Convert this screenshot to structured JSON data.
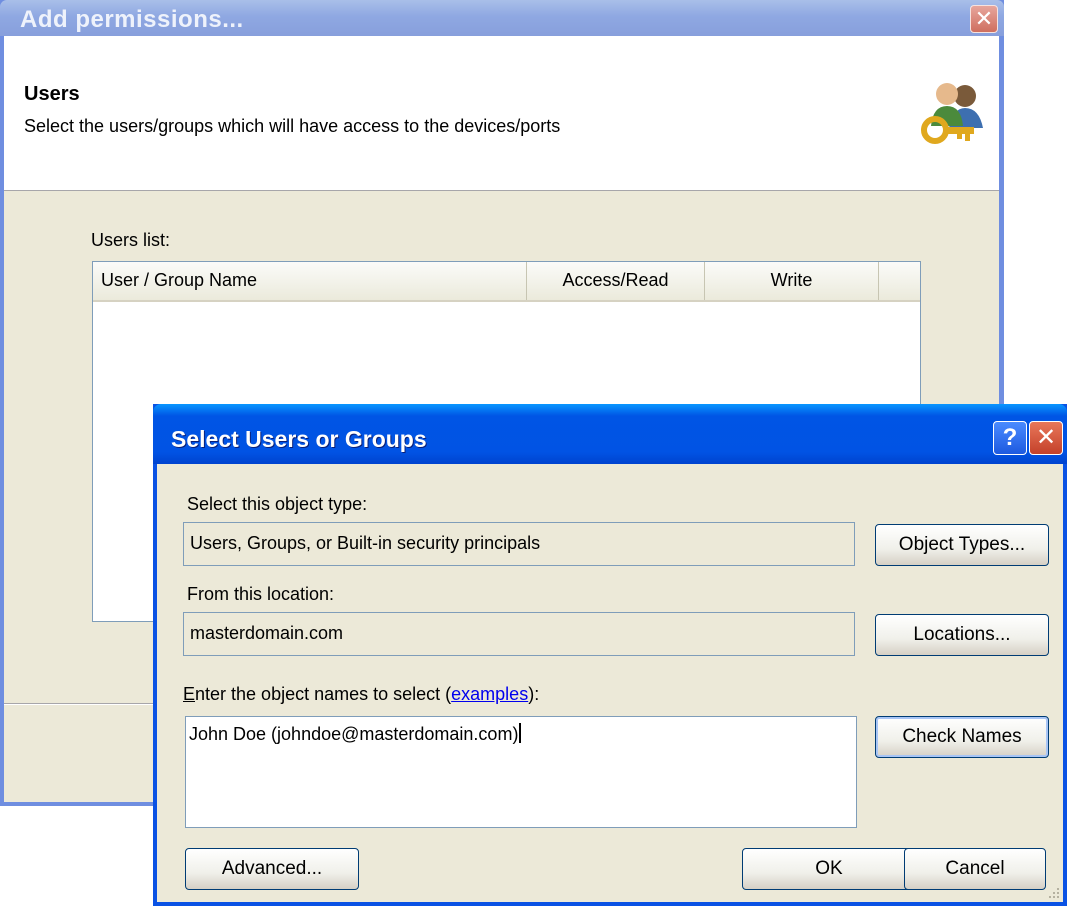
{
  "add_permissions": {
    "title": "Add permissions...",
    "header_title": "Users",
    "header_subtitle": "Select the users/groups which will have access  to the devices/ports",
    "users_list_label": "Users list:",
    "columns": [
      "User / Group Name",
      "Access/Read",
      "Write"
    ]
  },
  "select_dialog": {
    "title": "Select Users or Groups",
    "object_type_label": "Select this object type:",
    "object_type_value": "Users, Groups, or Built-in security principals",
    "object_types_button": "Object Types...",
    "location_label": "From this location:",
    "location_value": "masterdomain.com",
    "locations_button": "Locations...",
    "names_label_prefix_mnemonic": "E",
    "names_label_prefix_rest": "nter the object names to select (",
    "names_label_link": "examples",
    "names_label_suffix": "):",
    "names_value": "John Doe (johndoe@masterdomain.com)",
    "check_names_button": "Check Names",
    "advanced_button": "Advanced...",
    "ok_button": "OK",
    "cancel_button": "Cancel"
  },
  "colors": {
    "xp_blue_title": "#0055e5",
    "inactive_title": "#8fa8e2",
    "dialog_face": "#ece9d8"
  }
}
